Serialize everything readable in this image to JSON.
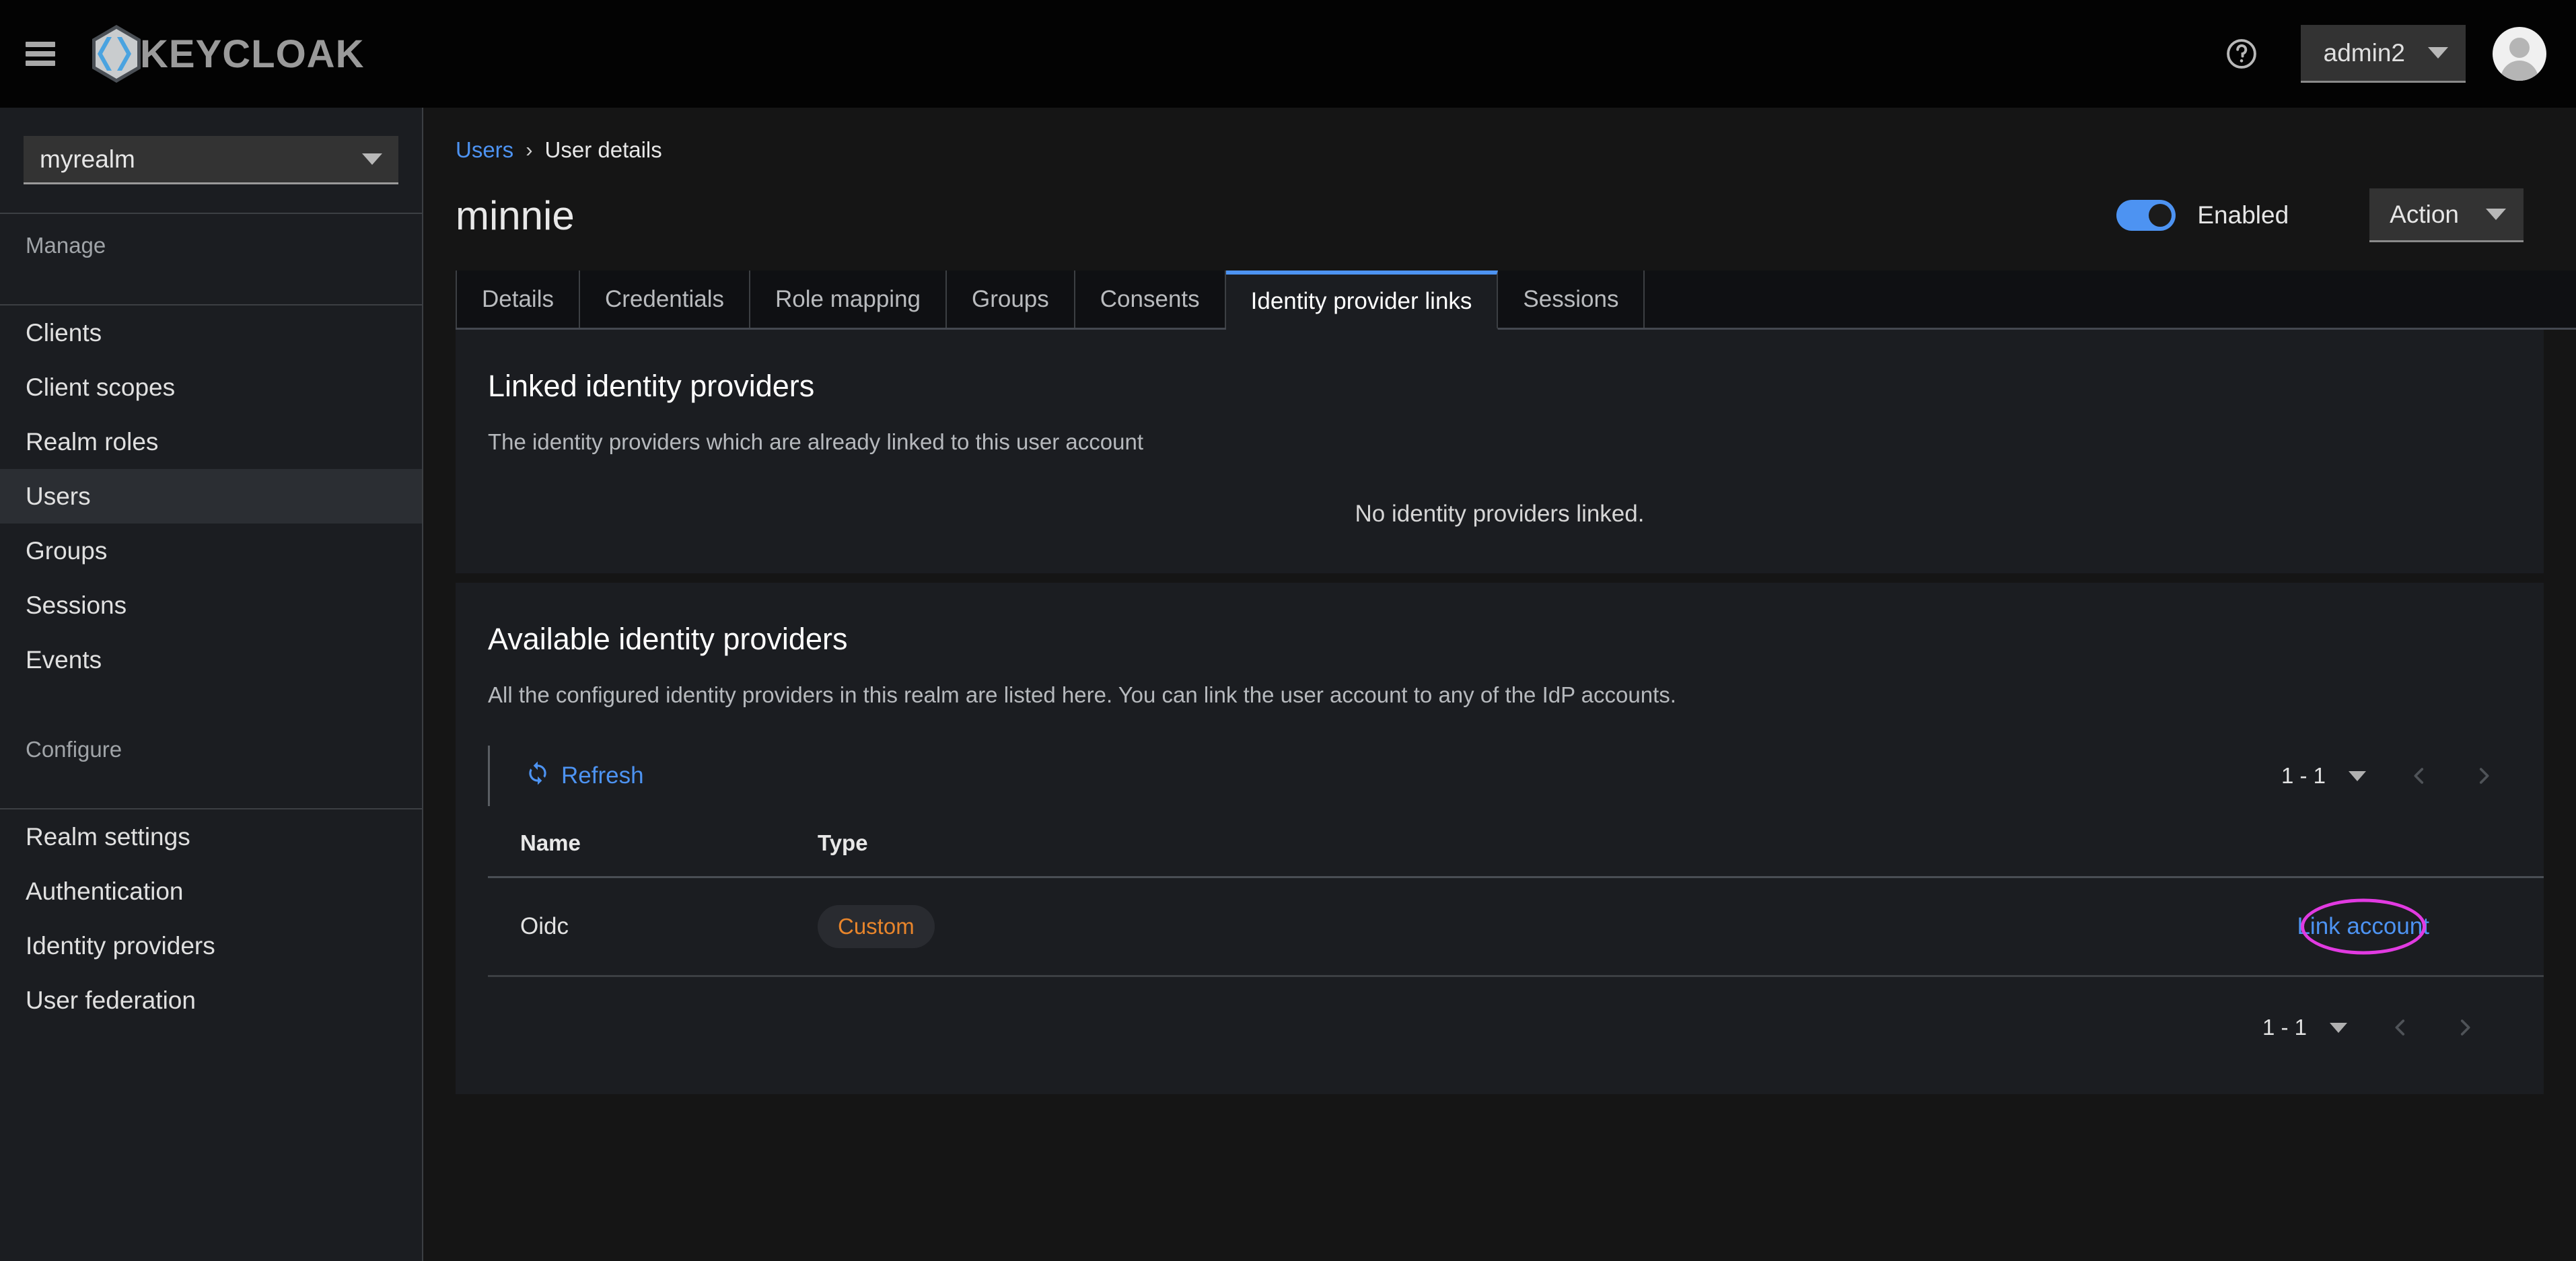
{
  "masthead": {
    "menu_icon": "hamburger-icon",
    "brand_name": "KEYCLOAK",
    "help_icon": "help-circle-icon",
    "user_name": "admin2",
    "avatar_icon": "user-avatar-icon"
  },
  "sidebar": {
    "realm_selected": "myrealm",
    "sections": [
      {
        "title": "Manage",
        "items": [
          "Clients",
          "Client scopes",
          "Realm roles",
          "Users",
          "Groups",
          "Sessions",
          "Events"
        ],
        "active": "Users"
      },
      {
        "title": "Configure",
        "items": [
          "Realm settings",
          "Authentication",
          "Identity providers",
          "User federation"
        ],
        "active": ""
      }
    ]
  },
  "main": {
    "breadcrumb": {
      "parent": "Users",
      "separator": "›",
      "current": "User details"
    },
    "page_title": "minnie",
    "toggle": {
      "state": "on",
      "label": "Enabled"
    },
    "action_button": "Action",
    "tabs": [
      {
        "label": "Details",
        "active": false
      },
      {
        "label": "Credentials",
        "active": false
      },
      {
        "label": "Role mapping",
        "active": false
      },
      {
        "label": "Groups",
        "active": false
      },
      {
        "label": "Consents",
        "active": false
      },
      {
        "label": "Identity provider links",
        "active": true
      },
      {
        "label": "Sessions",
        "active": false
      }
    ],
    "linked_card": {
      "title": "Linked identity providers",
      "description": "The identity providers which are already linked to this user account",
      "empty_message": "No identity providers linked."
    },
    "available_card": {
      "title": "Available identity providers",
      "description": "All the configured identity providers in this realm are listed here. You can link the user account to any of the IdP accounts.",
      "refresh_label": "Refresh",
      "refresh_icon": "sync-refresh-icon",
      "pagination": {
        "range": "1 - 1",
        "caret_icon": "chevron-down-icon",
        "prev_icon": "chevron-left-icon",
        "next_icon": "chevron-right-icon"
      },
      "columns": [
        "Name",
        "Type"
      ],
      "rows": [
        {
          "name": "Oidc",
          "type": "Custom",
          "action": "Link account"
        }
      ],
      "bottom_pagination": {
        "range": "1 - 1",
        "caret_icon": "chevron-down-icon",
        "prev_icon": "chevron-left-icon",
        "next_icon": "chevron-right-icon"
      }
    }
  },
  "colors": {
    "accent_blue": "#4d93f2",
    "masthead_bg": "#030303",
    "sidebar_bg": "#1b1d21",
    "page_bg": "#151515",
    "card_bg": "#1b1d21",
    "custom_orange": "#e8852b",
    "annotation_magenta": "#e13ae1"
  }
}
